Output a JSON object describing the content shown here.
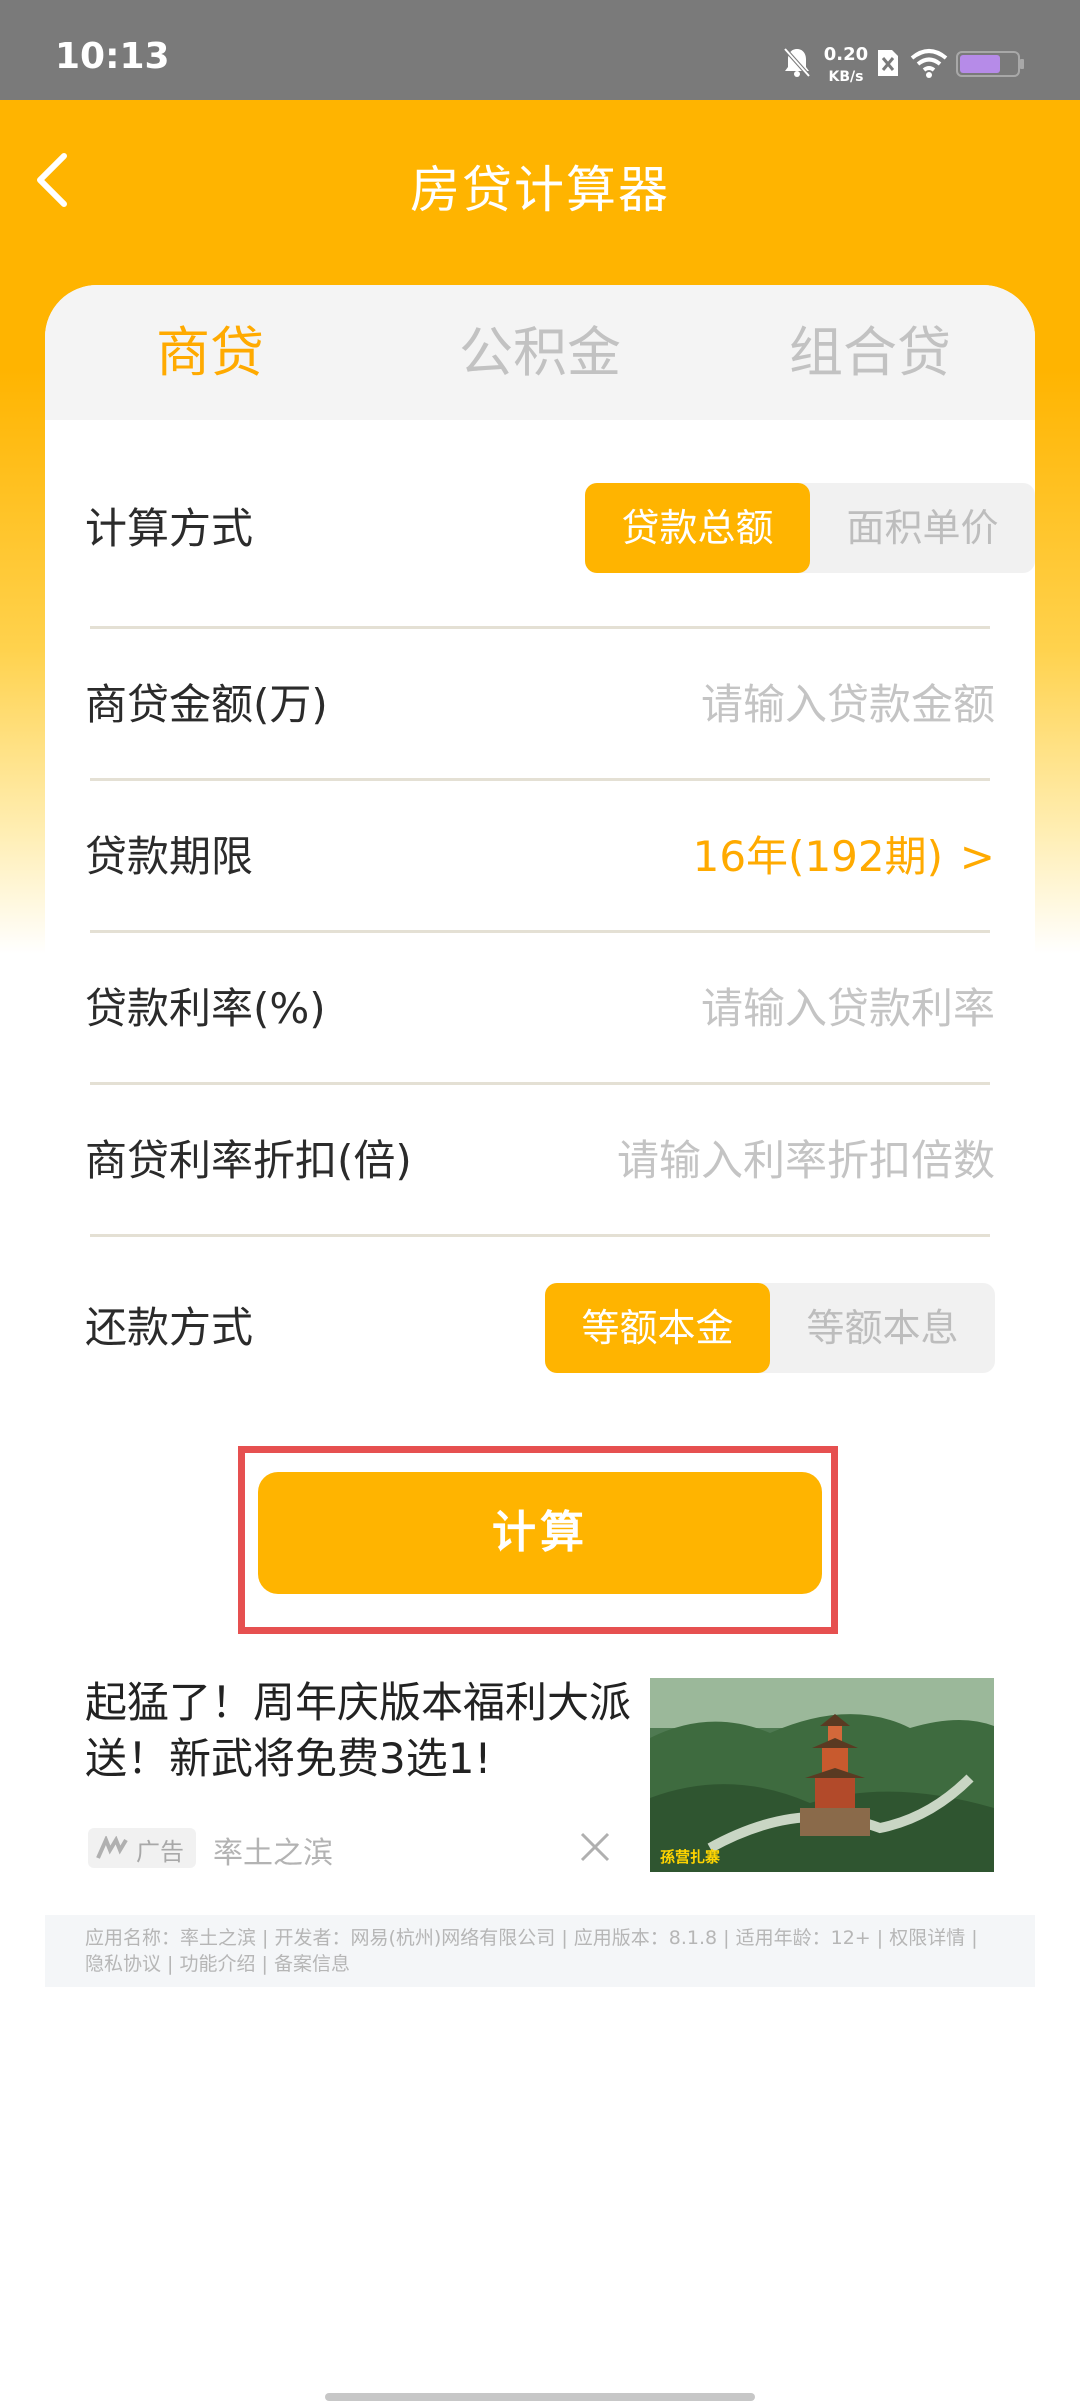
{
  "status_bar": {
    "time": "10:13",
    "net_speed": "0.20",
    "net_unit": "KB/s",
    "icons": [
      "mute-bell-icon",
      "sim-x-icon",
      "wifi-icon",
      "battery-icon"
    ]
  },
  "header": {
    "title": "房贷计算器",
    "back_icon": "chevron-left-icon"
  },
  "tabs": [
    {
      "label": "商贷",
      "active": true
    },
    {
      "label": "公积金",
      "active": false
    },
    {
      "label": "组合贷",
      "active": false
    }
  ],
  "form": {
    "calc_method": {
      "label": "计算方式",
      "options": [
        "贷款总额",
        "面积单价"
      ],
      "selected": "贷款总额"
    },
    "loan_amount": {
      "label": "商贷金额(万)",
      "placeholder": "请输入贷款金额"
    },
    "loan_term": {
      "label": "贷款期限",
      "value": "16年(192期)",
      "arrow": ">"
    },
    "interest_rate": {
      "label": "贷款利率(%)",
      "placeholder": "请输入贷款利率"
    },
    "rate_discount": {
      "label": "商贷利率折扣(倍)",
      "placeholder": "请输入利率折扣倍数"
    },
    "repayment": {
      "label": "还款方式",
      "options": [
        "等额本金",
        "等额本息"
      ],
      "selected": "等额本金"
    }
  },
  "calculate_button": {
    "label": "计算"
  },
  "ad": {
    "title": "起猛了！周年庆版本福利大派送！新武将免费3选1!",
    "badge": "广告",
    "source": "率土之滨",
    "image_caption": "孫营扎寨"
  },
  "app_info": "应用名称：率土之滨 | 开发者：网易(杭州)网络有限公司 | 应用版本：8.1.8 | 适用年龄：12+ | 权限详情 | 隐私协议 | 功能介绍 | 备案信息",
  "colors": {
    "accent": "#ffb400",
    "accent_text": "#ffaa00",
    "highlight_frame": "#e65050"
  }
}
